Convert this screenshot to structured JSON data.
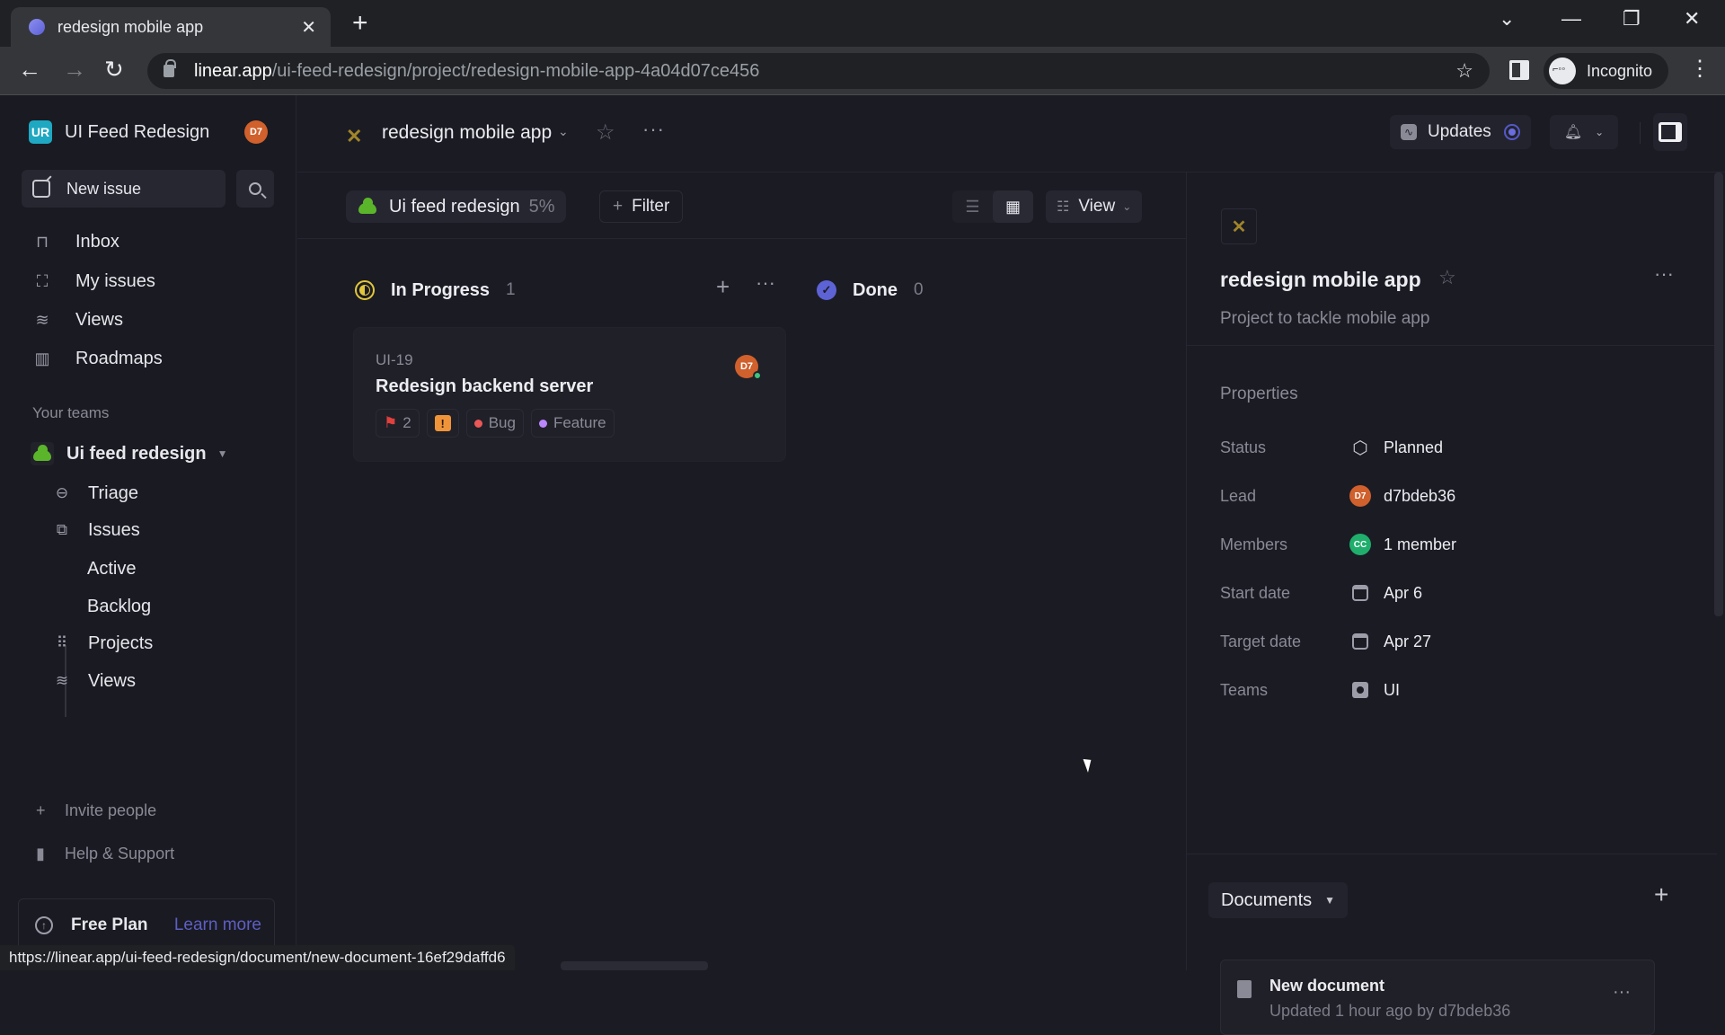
{
  "browser": {
    "tab_title": "redesign mobile app",
    "url_host": "linear.app",
    "url_path": "/ui-feed-redesign/project/redesign-mobile-app-4a04d07ce456",
    "profile_label": "Incognito",
    "status_url": "https://linear.app/ui-feed-redesign/document/new-document-16ef29daffd6"
  },
  "sidebar": {
    "workspace_initials": "UR",
    "workspace_name": "UI Feed Redesign",
    "user_initials": "D7",
    "new_issue_label": "New issue",
    "nav": [
      {
        "label": "Inbox",
        "icon": "inbox-icon"
      },
      {
        "label": "My issues",
        "icon": "focus-icon"
      },
      {
        "label": "Views",
        "icon": "layers-icon"
      },
      {
        "label": "Roadmaps",
        "icon": "map-icon"
      }
    ],
    "teams_section_label": "Your teams",
    "team": {
      "name": "Ui feed redesign",
      "items": [
        {
          "label": "Triage",
          "icon": "triage-icon"
        },
        {
          "label": "Issues",
          "icon": "issues-icon"
        },
        {
          "label": "Projects",
          "icon": "grid-icon"
        },
        {
          "label": "Views",
          "icon": "layers-icon"
        }
      ],
      "issue_subitems": [
        "Active",
        "Backlog"
      ]
    },
    "invite_label": "Invite people",
    "help_label": "Help & Support",
    "plan_label": "Free Plan",
    "plan_link": "Learn more"
  },
  "header": {
    "project_title": "redesign mobile app",
    "updates_label": "Updates"
  },
  "filterbar": {
    "team_chip_label": "Ui feed redesign",
    "team_chip_progress": "5%",
    "filter_label": "Filter",
    "view_label": "View"
  },
  "board": {
    "columns": [
      {
        "name": "In Progress",
        "count": "1",
        "color": "#e2c73a"
      },
      {
        "name": "Done",
        "count": "0",
        "color": "#5d63d4"
      }
    ],
    "cards": [
      {
        "id": "UI-19",
        "title": "Redesign backend server",
        "assignee_initials": "D7",
        "sub_issue_count": "2",
        "priority": "Urgent",
        "labels": [
          {
            "name": "Bug",
            "color": "#eb5757"
          },
          {
            "name": "Feature",
            "color": "#bb87fc"
          }
        ]
      }
    ]
  },
  "project_panel": {
    "title": "redesign mobile app",
    "description": "Project to tackle mobile app",
    "properties_heading": "Properties",
    "properties": [
      {
        "key": "Status",
        "value": "Planned"
      },
      {
        "key": "Lead",
        "value": "d7bdeb36",
        "avatar": "D7"
      },
      {
        "key": "Members",
        "value": "1 member",
        "avatar": "CC"
      },
      {
        "key": "Start date",
        "value": "Apr 6"
      },
      {
        "key": "Target date",
        "value": "Apr 27"
      },
      {
        "key": "Teams",
        "value": "UI"
      }
    ],
    "documents_label": "Documents",
    "documents": [
      {
        "title": "New document",
        "meta": "Updated 1 hour ago by d7bdeb36"
      }
    ]
  }
}
